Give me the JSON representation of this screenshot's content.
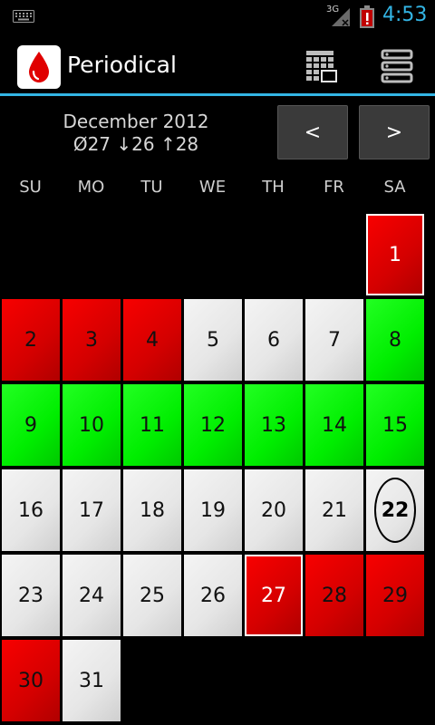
{
  "status_bar": {
    "network": "3G",
    "time": "4:53",
    "icons": [
      "keyboard-icon",
      "signal-icon",
      "battery-alert-icon"
    ]
  },
  "action_bar": {
    "title": "Periodical",
    "app_icon": "blood-drop-icon",
    "actions": [
      "calendar-icon",
      "list-icon"
    ]
  },
  "month": {
    "title": "December 2012",
    "stats": "Ø27 ↓26 ↑28",
    "prev_label": "<",
    "next_label": ">"
  },
  "weekdays": [
    "SU",
    "MO",
    "TU",
    "WE",
    "TH",
    "FR",
    "SA"
  ],
  "days": [
    {
      "day": "1",
      "type": "red",
      "bordered": true
    },
    {
      "day": "2",
      "type": "red"
    },
    {
      "day": "3",
      "type": "red"
    },
    {
      "day": "4",
      "type": "red"
    },
    {
      "day": "5",
      "type": "grey"
    },
    {
      "day": "6",
      "type": "grey"
    },
    {
      "day": "7",
      "type": "grey"
    },
    {
      "day": "8",
      "type": "green"
    },
    {
      "day": "9",
      "type": "green"
    },
    {
      "day": "10",
      "type": "green"
    },
    {
      "day": "11",
      "type": "green"
    },
    {
      "day": "12",
      "type": "green"
    },
    {
      "day": "13",
      "type": "green"
    },
    {
      "day": "14",
      "type": "green"
    },
    {
      "day": "15",
      "type": "green"
    },
    {
      "day": "16",
      "type": "grey"
    },
    {
      "day": "17",
      "type": "grey"
    },
    {
      "day": "18",
      "type": "grey"
    },
    {
      "day": "19",
      "type": "grey"
    },
    {
      "day": "20",
      "type": "grey"
    },
    {
      "day": "21",
      "type": "grey"
    },
    {
      "day": "22",
      "type": "grey",
      "today": true
    },
    {
      "day": "23",
      "type": "grey"
    },
    {
      "day": "24",
      "type": "grey"
    },
    {
      "day": "25",
      "type": "grey"
    },
    {
      "day": "26",
      "type": "grey"
    },
    {
      "day": "27",
      "type": "red",
      "bordered": true
    },
    {
      "day": "28",
      "type": "red"
    },
    {
      "day": "29",
      "type": "red"
    },
    {
      "day": "30",
      "type": "red"
    },
    {
      "day": "31",
      "type": "grey"
    }
  ],
  "colors": {
    "accent": "#33b5e5",
    "period": "#e00000",
    "fertile": "#00ee00",
    "normal": "#e6e6e6"
  }
}
